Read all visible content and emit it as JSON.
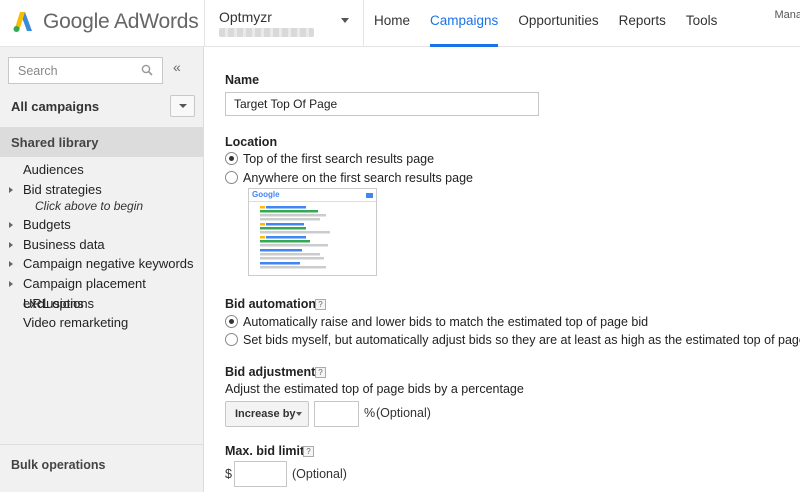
{
  "brand": {
    "product": "Google AdWords"
  },
  "account": {
    "name": "Optmyzr"
  },
  "nav": {
    "items": [
      "Home",
      "Campaigns",
      "Opportunities",
      "Reports",
      "Tools"
    ],
    "active": "Campaigns",
    "truncated_right": "Mana",
    "accent": "#1a73e8"
  },
  "sidebar": {
    "search_placeholder": "Search",
    "collapse_glyph": "«",
    "all_campaigns": "All campaigns",
    "shared_library": "Shared library",
    "library_items": [
      {
        "label": "Audiences",
        "expandable": false
      },
      {
        "label": "Bid strategies",
        "expandable": true
      },
      {
        "label": "Budgets",
        "expandable": true
      },
      {
        "label": "Business data",
        "expandable": true
      },
      {
        "label": "Campaign negative keywords",
        "expandable": true
      },
      {
        "label": "Campaign placement exclusions",
        "expandable": true
      },
      {
        "label": "URL options",
        "expandable": false
      },
      {
        "label": "Video remarketing",
        "expandable": false
      }
    ],
    "bid_strategies_hint": "Click above to begin",
    "bulk_operations": "Bulk operations"
  },
  "form": {
    "name": {
      "label": "Name",
      "value": "Target Top Of Page"
    },
    "location": {
      "label": "Location",
      "options": [
        {
          "label": "Top of the first search results page",
          "selected": true
        },
        {
          "label": "Anywhere on the first search results page",
          "selected": false
        }
      ],
      "preview_logo": "Google"
    },
    "bid_automation": {
      "label": "Bid automation",
      "help": "?",
      "options": [
        {
          "label": "Automatically raise and lower bids to match the estimated top of page bid",
          "selected": true
        },
        {
          "label": "Set bids myself, but automatically adjust bids so they are at least as high as the estimated top of page bid",
          "selected": false
        }
      ]
    },
    "bid_adjustment": {
      "label": "Bid adjustment",
      "help": "?",
      "description": "Adjust the estimated top of page bids by a percentage",
      "mode": "Increase by",
      "value": "",
      "unit": "%",
      "optional": "(Optional)"
    },
    "max_bid_limit": {
      "label": "Max. bid limit",
      "help": "?",
      "currency": "$",
      "value": "",
      "optional": "(Optional)"
    }
  }
}
